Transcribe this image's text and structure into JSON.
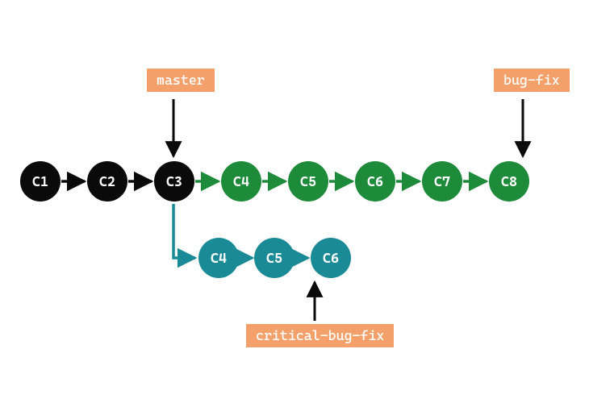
{
  "diagram": {
    "colors": {
      "master_branch": "#0a0a0a",
      "bugfix_branch": "#1e8b3a",
      "critical_branch": "#1a8a96",
      "label_bg": "#f3a06a",
      "label_text": "#ffffff",
      "arrow_black": "#0a0a0a"
    },
    "branches": {
      "master": {
        "label": "master",
        "points_to": "C3",
        "commits": [
          "C1",
          "C2",
          "C3"
        ]
      },
      "bugfix": {
        "label": "bug-fix",
        "points_to": "C8",
        "commits": [
          "C4",
          "C5",
          "C6",
          "C7",
          "C8"
        ]
      },
      "critical": {
        "label": "critical-bug-fix",
        "points_to": "C6",
        "commits": [
          "C4",
          "C5",
          "C6"
        ]
      }
    },
    "commits": {
      "main_row": [
        {
          "id": "C1",
          "color": "master"
        },
        {
          "id": "C2",
          "color": "master"
        },
        {
          "id": "C3",
          "color": "master"
        },
        {
          "id": "C4",
          "color": "bugfix"
        },
        {
          "id": "C5",
          "color": "bugfix"
        },
        {
          "id": "C6",
          "color": "bugfix"
        },
        {
          "id": "C7",
          "color": "bugfix"
        },
        {
          "id": "C8",
          "color": "bugfix"
        }
      ],
      "critical_row": [
        {
          "id": "C4",
          "color": "critical"
        },
        {
          "id": "C5",
          "color": "critical"
        },
        {
          "id": "C6",
          "color": "critical"
        }
      ]
    }
  }
}
